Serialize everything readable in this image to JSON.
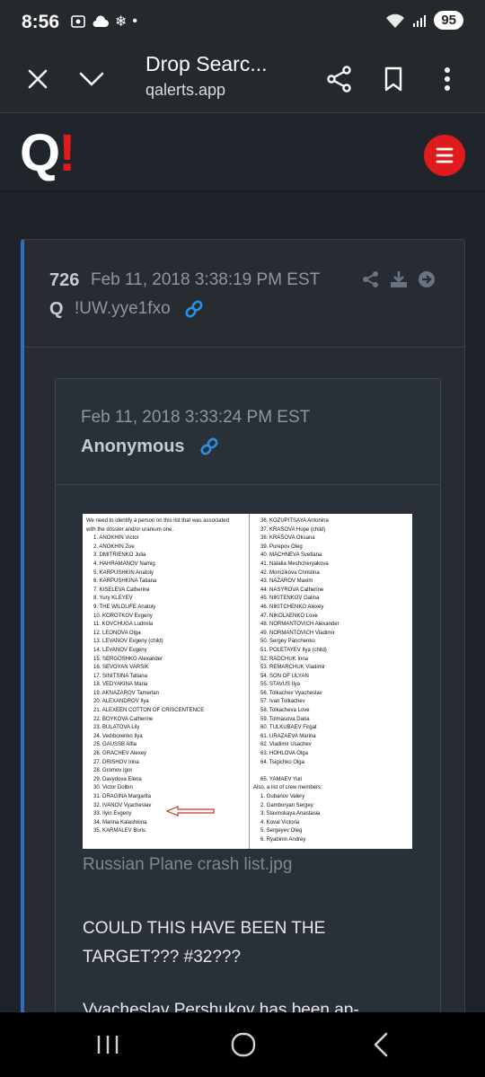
{
  "status": {
    "time": "8:56",
    "battery": "95"
  },
  "toolbar": {
    "title": "Drop Searc...",
    "url": "qalerts.app"
  },
  "site": {
    "logo_q": "Q",
    "logo_bang": "!"
  },
  "post": {
    "number": "726",
    "date": "Feb 11, 2018 3:38:19 PM EST",
    "author": "Q",
    "tripcode": "!UW.yye1fxo"
  },
  "quote": {
    "date": "Feb 11, 2018 3:33:24 PM EST",
    "author": "Anonymous",
    "image_caption": "Russian Plane crash list.jpg",
    "text1": "COULD THIS HAVE BEEN THE TARGET??? #32???",
    "text2": "Vyacheslav Pershukov has been ap-"
  },
  "document": {
    "left": [
      "We need to identify a person on this list that was associated",
      "with the dossier and/or uranium one.",
      "1. ANOKHIN Victor",
      "2. ANOKHIN Zoe",
      "3. DMITRIENKO Julia",
      "4. HAHRAMANOV Namig",
      "5. KARPUSHKIN Anatoly",
      "6. KARPUSHKINA Tatiana",
      "7. KISELEVA Catherine",
      "8. Yury KLEYEV",
      "9. THE WILDLIFE Anatoly",
      "10. KOROTKOV Evgeny",
      "11. KOVCHUGA Ludmila",
      "12. LEONOVA Olga",
      "13. LEVANOV Evgeny (child)",
      "14. LEVANOV Evgeny",
      "15. SERGOSHKO Alexander",
      "16. SEVOYAN VARSIK",
      "17. SINITSINA Tatiana",
      "18. VEDYAKINA Maria",
      "19. AKNAZAROV Tamerlan",
      "20. ALEXANDROV Ilya",
      "21. ALEXEEN COTTON OF CRISCENTENCE",
      "22. BOYKOVA Catherine",
      "23. BULATOVA Lily",
      "24. Vedıborenko Ilya",
      "25. GAUSSB Alfia",
      "26. GRACHEV Alexey",
      "27. DRISHOV Irina",
      "28. Gromov Igor",
      "29. Davydova Elena",
      "30. Victor Dolbin",
      "31. DRAGINA Margarita",
      "32. IVANOV Vyacheslav",
      "33. Ilyin Evgeny",
      "34. Marina Kalashkina",
      "35. KARMALEV Boris"
    ],
    "right": [
      "36. KOZUPITSAYA Antonina",
      "37. KRASOVA Hope (child)",
      "38. KRASOVA Oksana",
      "39. Purepov Oleg",
      "40. MACHNEVA Svetlana",
      "41. Natalia Meshcheryakova",
      "42. Momzikova Christina",
      "43. NAZAROV Maxim",
      "44. NASYROVA Catherine",
      "45. NIKITENKOV Galina",
      "46. NIKITCHENKO Alexey",
      "47. NIKOLAENKO Love",
      "48. NORMANTOVICH Alexander",
      "49. NORMANTOVICH Vladimir",
      "50. Sergey Panchenko",
      "51. POLETAYEV Ilya (child)",
      "52. RADCHUK Inna",
      "53. REMARCHUK Vladimir",
      "54. SON OF ULYAN",
      "55. STAVUS Ilya",
      "56. Tolkachev Vyacheslav",
      "57. Ivan Tolkachev",
      "58. Tolkacheva Love",
      "59. Tolmasova Daria",
      "60. TULKUBAEV Firgat",
      "61. URAZAEVA Marina",
      "62. Vladimir Usachev",
      "63. HOHLOVA Olga",
      "64. Tsigichko Olga",
      "",
      "65. YAMAEV Yuri",
      "Also, a list of crew members:",
      "1. Gubanov Valery",
      "2. Gamboryan Sergey",
      "3. Slavinskaya Anastasia",
      "4. Koval Victoria",
      "5. Sergeyev Oleg",
      "6. Ryabinin Andrey"
    ]
  }
}
